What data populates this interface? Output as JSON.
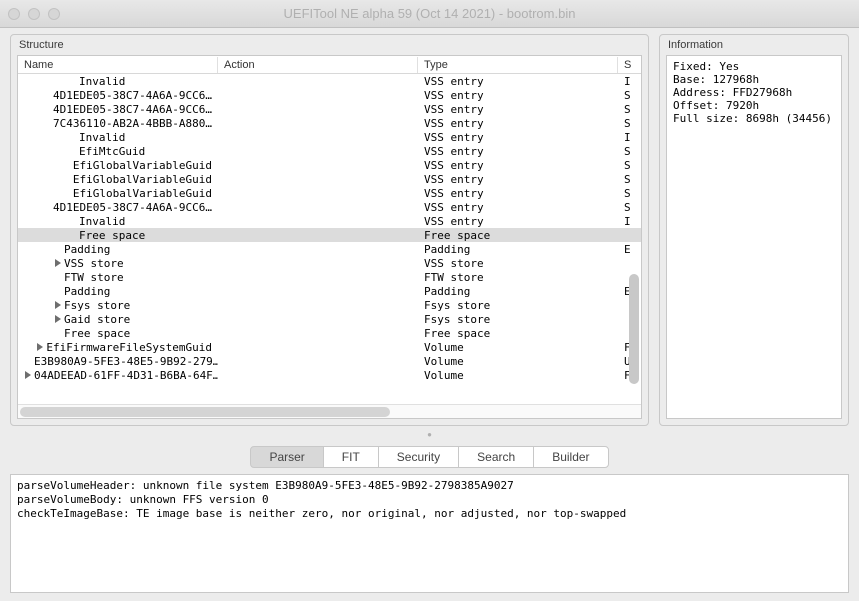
{
  "window": {
    "title": "UEFITool NE alpha 59 (Oct 14 2021) - bootrom.bin"
  },
  "panels": {
    "structure": "Structure",
    "information": "Information"
  },
  "columns": {
    "name": "Name",
    "action": "Action",
    "type": "Type",
    "s": "S"
  },
  "rows": [
    {
      "indent": 3,
      "arrow": "",
      "name": "Invalid",
      "type": "VSS entry",
      "s": "I",
      "sel": false
    },
    {
      "indent": 3,
      "arrow": "",
      "name": "4D1EDE05-38C7-4A6A-9CC6…",
      "type": "VSS entry",
      "s": "S",
      "sel": false
    },
    {
      "indent": 3,
      "arrow": "",
      "name": "4D1EDE05-38C7-4A6A-9CC6…",
      "type": "VSS entry",
      "s": "S",
      "sel": false
    },
    {
      "indent": 3,
      "arrow": "",
      "name": "7C436110-AB2A-4BBB-A880…",
      "type": "VSS entry",
      "s": "S",
      "sel": false
    },
    {
      "indent": 3,
      "arrow": "",
      "name": "Invalid",
      "type": "VSS entry",
      "s": "I",
      "sel": false
    },
    {
      "indent": 3,
      "arrow": "",
      "name": "EfiMtcGuid",
      "type": "VSS entry",
      "s": "S",
      "sel": false
    },
    {
      "indent": 3,
      "arrow": "",
      "name": "EfiGlobalVariableGuid",
      "type": "VSS entry",
      "s": "S",
      "sel": false
    },
    {
      "indent": 3,
      "arrow": "",
      "name": "EfiGlobalVariableGuid",
      "type": "VSS entry",
      "s": "S",
      "sel": false
    },
    {
      "indent": 3,
      "arrow": "",
      "name": "EfiGlobalVariableGuid",
      "type": "VSS entry",
      "s": "S",
      "sel": false
    },
    {
      "indent": 3,
      "arrow": "",
      "name": "4D1EDE05-38C7-4A6A-9CC6…",
      "type": "VSS entry",
      "s": "S",
      "sel": false
    },
    {
      "indent": 3,
      "arrow": "",
      "name": "Invalid",
      "type": "VSS entry",
      "s": "I",
      "sel": false
    },
    {
      "indent": 3,
      "arrow": "",
      "name": "Free space",
      "type": "Free space",
      "s": "",
      "sel": true
    },
    {
      "indent": 2,
      "arrow": "",
      "name": "Padding",
      "type": "Padding",
      "s": "E",
      "sel": false
    },
    {
      "indent": 2,
      "arrow": "r",
      "name": "VSS store",
      "type": "VSS store",
      "s": "",
      "sel": false
    },
    {
      "indent": 2,
      "arrow": "",
      "name": "FTW store",
      "type": "FTW store",
      "s": "",
      "sel": false
    },
    {
      "indent": 2,
      "arrow": "",
      "name": "Padding",
      "type": "Padding",
      "s": "E",
      "sel": false
    },
    {
      "indent": 2,
      "arrow": "r",
      "name": "Fsys store",
      "type": "Fsys store",
      "s": "",
      "sel": false
    },
    {
      "indent": 2,
      "arrow": "r",
      "name": "Gaid store",
      "type": "Fsys store",
      "s": "",
      "sel": false
    },
    {
      "indent": 2,
      "arrow": "",
      "name": "Free space",
      "type": "Free space",
      "s": "",
      "sel": false
    },
    {
      "indent": 1,
      "arrow": "r",
      "name": "EfiFirmwareFileSystemGuid",
      "type": "Volume",
      "s": "F",
      "sel": false
    },
    {
      "indent": 1,
      "arrow": "",
      "name": "E3B980A9-5FE3-48E5-9B92-279…",
      "type": "Volume",
      "s": "U",
      "sel": false
    },
    {
      "indent": 1,
      "arrow": "r",
      "name": "04ADEEAD-61FF-4D31-B6BA-64F…",
      "type": "Volume",
      "s": "F",
      "sel": false
    }
  ],
  "info": {
    "line0": "Fixed: Yes",
    "line1": "Base: 127968h",
    "line2": "Address: FFD27968h",
    "line3": "Offset: 7920h",
    "line4": "Full size: 8698h (34456)"
  },
  "tabs": {
    "parser": "Parser",
    "fit": "FIT",
    "security": "Security",
    "search": "Search",
    "builder": "Builder"
  },
  "log": {
    "line0": "parseVolumeHeader: unknown file system E3B980A9-5FE3-48E5-9B92-2798385A9027",
    "line1": "parseVolumeBody: unknown FFS version 0",
    "line2": "checkTeImageBase: TE image base is neither zero, nor original, nor adjusted, nor top-swapped"
  }
}
